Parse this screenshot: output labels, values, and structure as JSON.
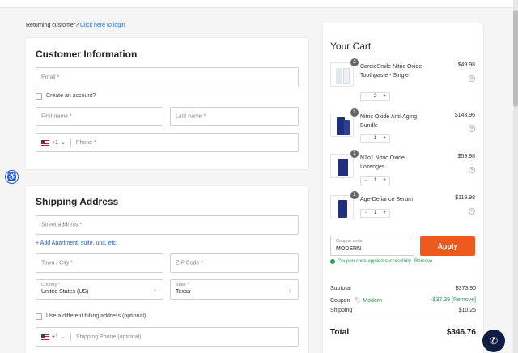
{
  "returning": {
    "prompt": "Returning customer?",
    "link": "Click here to login"
  },
  "customer": {
    "title": "Customer Information",
    "email_placeholder": "Email *",
    "create_account_label": "Create an account?",
    "first_name_placeholder": "First name *",
    "last_name_placeholder": "Last name *",
    "phone_code": "+1",
    "phone_placeholder": "Phone *"
  },
  "shipping": {
    "title": "Shipping Address",
    "street_placeholder": "Street address *",
    "add_apartment_link": "+ Add Apartment, suite, unit, etc.",
    "city_placeholder": "Town / City *",
    "zip_placeholder": "ZIP Code *",
    "country_label": "Country *",
    "country_value": "United States (US)",
    "state_label": "State *",
    "state_value": "Texas",
    "billing_checkbox_label": "Use a different billing address (optional)",
    "phone_code": "+1",
    "phone_placeholder": "Shipping Phone (optional)"
  },
  "cart": {
    "title": "Your Cart",
    "items": [
      {
        "name": "CardioSmile Nitric Oxide Toothpaste - Single",
        "price": "$49.98",
        "qty": "2",
        "badge": "2"
      },
      {
        "name": "Nitric Oxide Anti-Aging Bundle",
        "price": "$143.96",
        "qty": "1",
        "badge": "1"
      },
      {
        "name": "N1o1 Nitric Oxide Lozenges",
        "price": "$59.98",
        "qty": "1",
        "badge": "1"
      },
      {
        "name": "Age-Defiance Serum",
        "price": "$119.98",
        "qty": "1",
        "badge": "1"
      }
    ],
    "minus": "-",
    "plus": "+",
    "coupon_label": "Coupon code",
    "coupon_value": "MODERN",
    "apply_label": "Apply",
    "coupon_success": "Coupon code applied successfully.",
    "coupon_remove_link": "Remove",
    "subtotal_label": "Subtotal",
    "subtotal_value": "$373.90",
    "coupon_row_label": "Coupon",
    "coupon_row_code": "Modern",
    "coupon_row_value": "-$37.39",
    "coupon_row_remove": "[Remove]",
    "shipping_label": "Shipping",
    "shipping_value": "$10.25",
    "total_label": "Total",
    "total_value": "$346.76"
  },
  "colors": {
    "accent": "#ee5a1d",
    "link": "#1a5fd1",
    "success": "#1e9d4b",
    "chat": "#0f1c44"
  }
}
